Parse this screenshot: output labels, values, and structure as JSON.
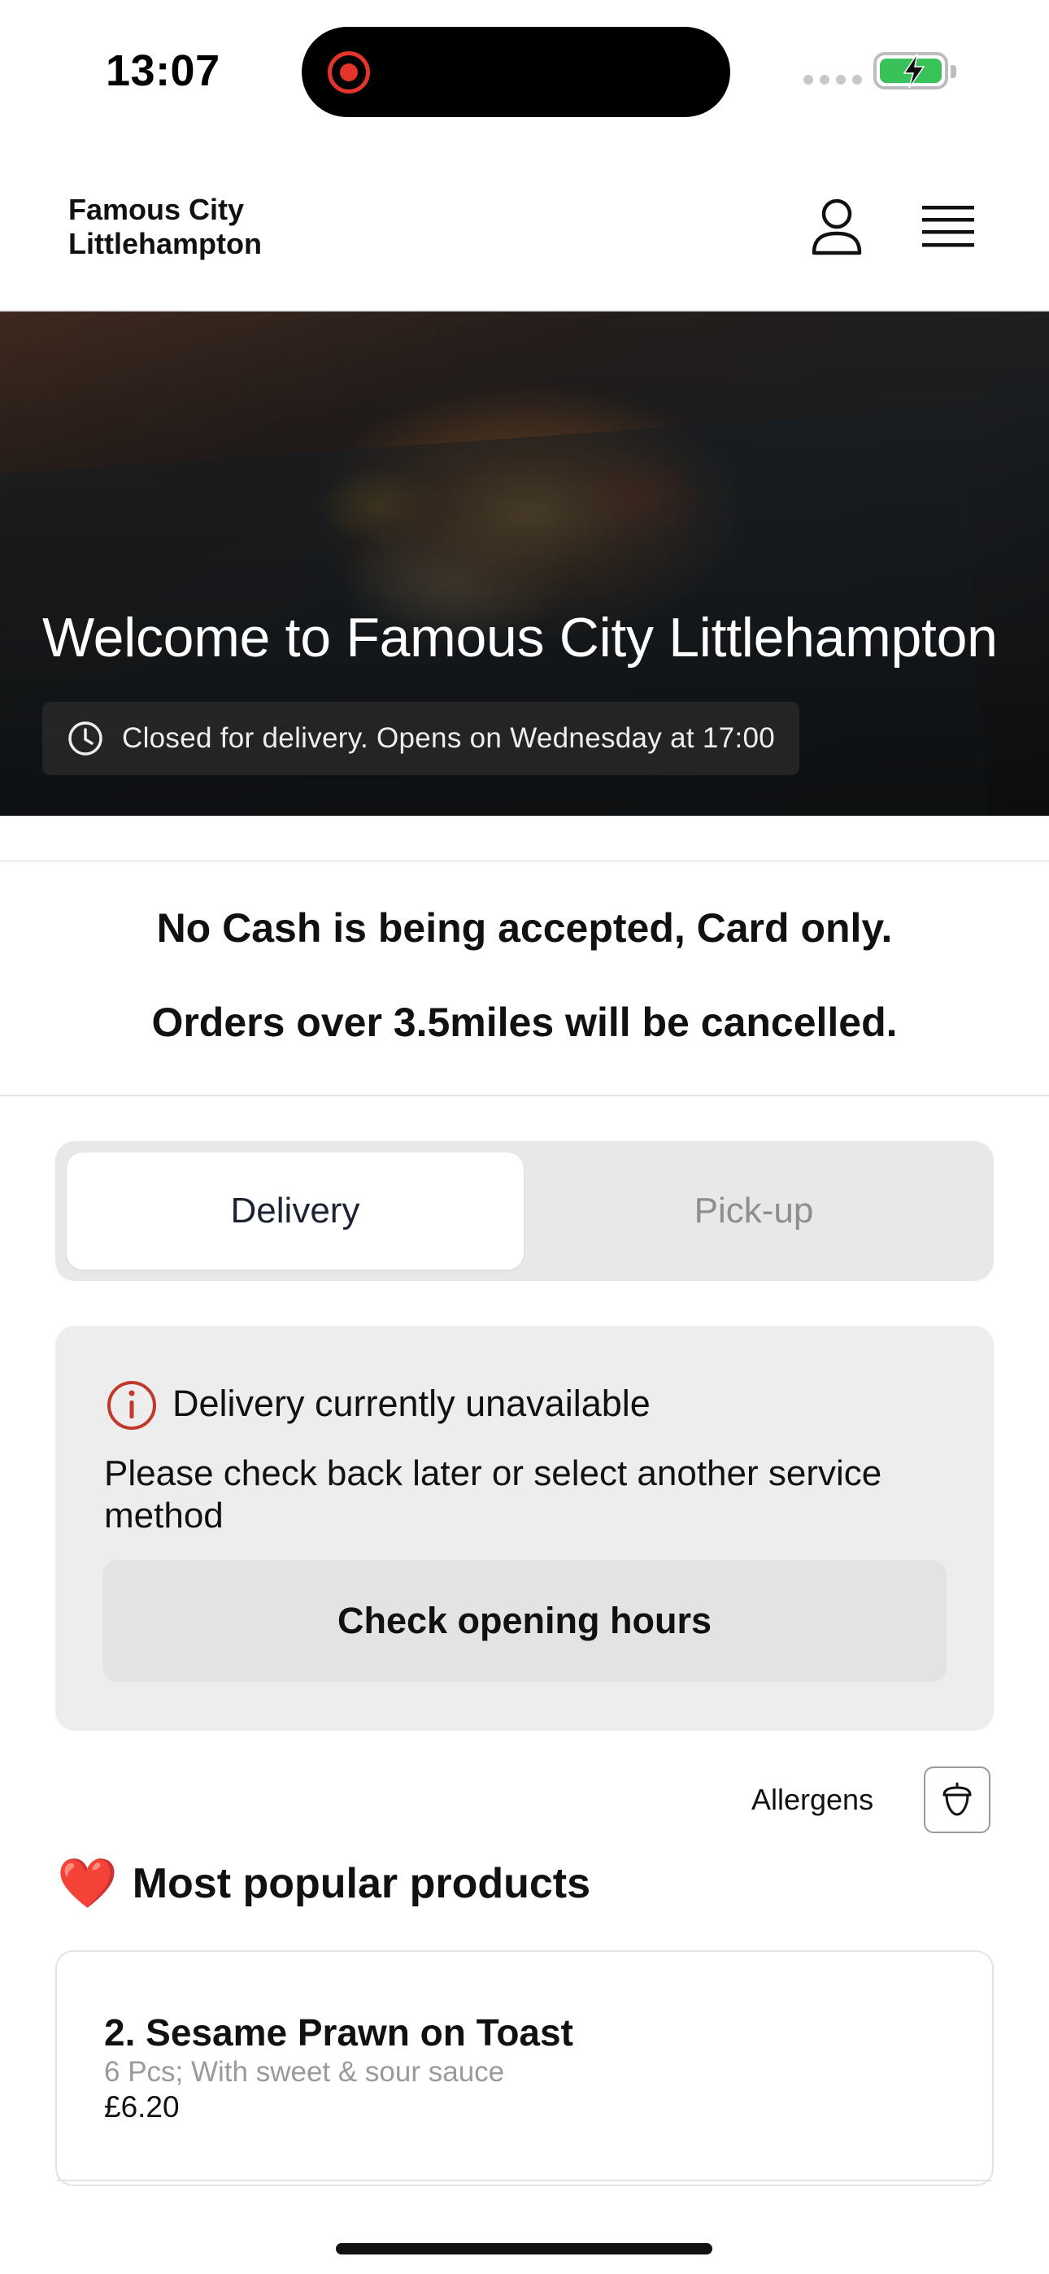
{
  "status_bar": {
    "time": "13:07",
    "recording_icon": "screen-record-icon",
    "battery_icon": "battery-charging-icon",
    "signal_icon": "signal-dots-icon",
    "battery_color": "#3ac25a",
    "record_color": "#e3352b"
  },
  "header": {
    "brand_line1": "Famous City",
    "brand_line2": "Littlehampton",
    "account_icon": "user-icon",
    "menu_icon": "hamburger-menu-icon"
  },
  "hero": {
    "title": "Welcome to Famous City Littlehampton",
    "status_icon": "clock-icon",
    "status_text": "Closed for delivery. Opens on Wednesday at 17:00"
  },
  "notice": {
    "line1": "No Cash is being accepted, Card only.",
    "line2": "Orders over 3.5miles will be cancelled."
  },
  "service_toggle": {
    "options": [
      "Delivery",
      "Pick-up"
    ],
    "selected": "Delivery"
  },
  "unavailable_card": {
    "icon": "info-warning-icon",
    "title": "Delivery currently unavailable",
    "description": "Please check back later or select another service method",
    "button_label": "Check opening hours",
    "accent_color": "#c0392b"
  },
  "allergens": {
    "label": "Allergens",
    "icon": "acorn-icon"
  },
  "popular": {
    "emoji": "❤️",
    "heading": "Most popular products",
    "products": [
      {
        "name": "2. Sesame Prawn on Toast",
        "description": "6 Pcs; With sweet & sour sauce",
        "price": "£6.20"
      }
    ]
  }
}
